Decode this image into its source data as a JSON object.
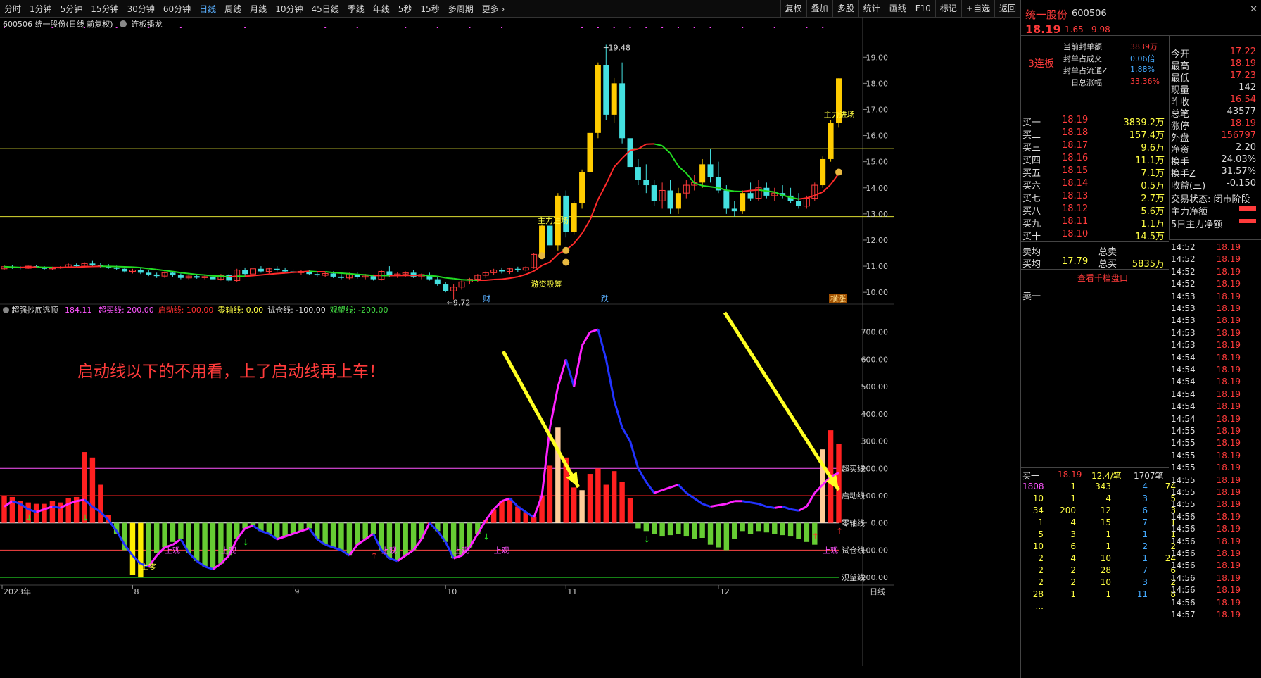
{
  "toolbar": {
    "periods": [
      "分时",
      "1分钟",
      "5分钟",
      "15分钟",
      "30分钟",
      "60分钟",
      "日线",
      "周线",
      "月线",
      "10分钟",
      "45日线",
      "季线",
      "年线",
      "5秒",
      "15秒",
      "多周期",
      "更多 ›"
    ],
    "active": "日线",
    "right_buttons": [
      "复权",
      "叠加",
      "多股",
      "统计",
      "画线",
      "F10",
      "标记",
      "+自选",
      "返回"
    ]
  },
  "chart_header": {
    "title": "600506 统一股份(日线 前复权)",
    "indicator": "连板播龙"
  },
  "price_axis": [
    "19.00",
    "18.00",
    "17.00",
    "16.00",
    "15.00",
    "14.00",
    "13.00",
    "12.00",
    "11.00",
    "10.00"
  ],
  "annotations": {
    "high": "19.48",
    "low": "9.72",
    "main_force_in_1": "主力进场",
    "main_force_in_2": "主力进场",
    "hot_money": "游资吸筹",
    "cai": "财",
    "die": "跌",
    "heng": "横涨"
  },
  "indicator_bar": {
    "name": "超强抄底逃顶",
    "value": "184.11",
    "lines": [
      {
        "label": "超买线: 200.00",
        "color": "#ff55ff"
      },
      {
        "label": "启动线: 100.00",
        "color": "#ff3030"
      },
      {
        "label": "零轴线: 0.00",
        "color": "#ffff44"
      },
      {
        "label": "试仓线: -100.00",
        "color": "#dddddd"
      },
      {
        "label": "观望线: -200.00",
        "color": "#44dd44"
      }
    ]
  },
  "lower_axis": [
    "700.00",
    "600.00",
    "500.00",
    "400.00",
    "300.00",
    "200.00",
    "100.00",
    "0.00",
    "-100.00",
    "-200.00"
  ],
  "lower_line_labels": [
    "超买线",
    "启动线",
    "零轴线",
    "试仓线",
    "观望线"
  ],
  "big_note": "启动线以下的不用看，上了启动线再上车！",
  "signal_labels": {
    "shang_ling": "上零",
    "shang_guan": "上观"
  },
  "date_axis": {
    "labels": [
      "2023年",
      "8",
      "9",
      "10",
      "11",
      "12"
    ],
    "period": "日线"
  },
  "chart_data": {
    "type": "candlestick",
    "ylim": [
      9.6,
      19.6
    ],
    "mid_lines": [
      15.5,
      12.9
    ],
    "ohlc": [
      [
        10.9,
        11.05,
        10.85,
        10.98
      ],
      [
        10.98,
        11.05,
        10.9,
        10.95
      ],
      [
        10.95,
        11.0,
        10.88,
        10.92
      ],
      [
        10.92,
        11.02,
        10.9,
        11.0
      ],
      [
        11.0,
        11.05,
        10.95,
        10.97
      ],
      [
        10.97,
        11.0,
        10.86,
        10.9
      ],
      [
        10.9,
        10.98,
        10.85,
        10.93
      ],
      [
        10.93,
        11.0,
        10.9,
        10.96
      ],
      [
        10.96,
        11.1,
        10.92,
        11.05
      ],
      [
        11.05,
        11.1,
        10.98,
        11.0
      ],
      [
        11.0,
        11.15,
        10.95,
        11.1
      ],
      [
        11.1,
        11.2,
        11.0,
        11.05
      ],
      [
        11.05,
        11.12,
        10.95,
        11.0
      ],
      [
        11.0,
        11.08,
        10.9,
        10.95
      ],
      [
        10.95,
        11.02,
        10.85,
        10.9
      ],
      [
        10.9,
        10.95,
        10.75,
        10.8
      ],
      [
        10.8,
        10.9,
        10.72,
        10.85
      ],
      [
        10.85,
        10.92,
        10.7,
        10.75
      ],
      [
        10.75,
        10.85,
        10.62,
        10.68
      ],
      [
        10.68,
        10.75,
        10.55,
        10.62
      ],
      [
        10.62,
        10.8,
        10.55,
        10.75
      ],
      [
        10.75,
        10.8,
        10.6,
        10.65
      ],
      [
        10.65,
        10.72,
        10.5,
        10.55
      ],
      [
        10.55,
        10.7,
        10.48,
        10.62
      ],
      [
        10.62,
        10.7,
        10.52,
        10.56
      ],
      [
        10.56,
        10.66,
        10.5,
        10.6
      ],
      [
        10.6,
        10.65,
        10.45,
        10.5
      ],
      [
        10.5,
        10.7,
        10.45,
        10.65
      ],
      [
        10.65,
        10.7,
        10.4,
        10.45
      ],
      [
        10.45,
        10.9,
        10.4,
        10.85
      ],
      [
        10.85,
        10.95,
        10.6,
        10.7
      ],
      [
        10.7,
        10.95,
        10.65,
        10.9
      ],
      [
        10.9,
        11.0,
        10.75,
        10.8
      ],
      [
        10.8,
        10.95,
        10.72,
        10.9
      ],
      [
        10.9,
        11.0,
        10.8,
        10.85
      ],
      [
        10.85,
        10.95,
        10.75,
        10.8
      ],
      [
        10.8,
        10.88,
        10.7,
        10.75
      ],
      [
        10.75,
        10.85,
        10.68,
        10.8
      ],
      [
        10.8,
        10.85,
        10.65,
        10.7
      ],
      [
        10.7,
        10.8,
        10.6,
        10.65
      ],
      [
        10.65,
        10.78,
        10.58,
        10.72
      ],
      [
        10.72,
        10.8,
        10.55,
        10.6
      ],
      [
        10.6,
        10.7,
        10.5,
        10.55
      ],
      [
        10.55,
        10.75,
        10.5,
        10.7
      ],
      [
        10.7,
        10.78,
        10.52,
        10.58
      ],
      [
        10.58,
        10.7,
        10.5,
        10.62
      ],
      [
        10.62,
        10.68,
        10.45,
        10.5
      ],
      [
        10.5,
        10.85,
        10.45,
        10.8
      ],
      [
        10.8,
        11.0,
        10.6,
        10.65
      ],
      [
        10.65,
        10.78,
        10.55,
        10.7
      ],
      [
        10.7,
        10.8,
        10.6,
        10.75
      ],
      [
        10.75,
        10.85,
        10.55,
        10.6
      ],
      [
        10.6,
        10.72,
        10.5,
        10.68
      ],
      [
        10.68,
        10.75,
        10.45,
        10.5
      ],
      [
        10.5,
        10.6,
        10.25,
        10.3
      ],
      [
        10.3,
        10.4,
        10.0,
        10.05
      ],
      [
        10.05,
        10.3,
        9.72,
        10.2
      ],
      [
        10.2,
        10.45,
        10.1,
        10.4
      ],
      [
        10.4,
        10.55,
        10.3,
        10.5
      ],
      [
        10.5,
        10.7,
        10.4,
        10.65
      ],
      [
        10.65,
        10.8,
        10.55,
        10.75
      ],
      [
        10.75,
        10.9,
        10.65,
        10.85
      ],
      [
        10.85,
        10.95,
        10.72,
        10.8
      ],
      [
        10.8,
        10.95,
        10.7,
        10.9
      ],
      [
        10.9,
        10.98,
        10.78,
        10.85
      ],
      [
        10.85,
        11.0,
        10.8,
        10.95
      ],
      [
        10.95,
        11.5,
        10.9,
        11.45
      ],
      [
        11.45,
        12.6,
        11.4,
        12.55
      ],
      [
        12.55,
        12.7,
        11.7,
        11.8
      ],
      [
        11.8,
        13.8,
        11.6,
        13.7
      ],
      [
        13.7,
        13.9,
        12.1,
        12.3
      ],
      [
        12.3,
        13.5,
        12.2,
        13.4
      ],
      [
        13.4,
        14.7,
        13.2,
        14.6
      ],
      [
        14.6,
        16.2,
        14.5,
        16.1
      ],
      [
        16.1,
        18.8,
        15.9,
        18.7
      ],
      [
        18.7,
        19.48,
        16.6,
        16.8
      ],
      [
        16.8,
        18.2,
        16.5,
        18.0
      ],
      [
        18.0,
        18.8,
        15.7,
        15.9
      ],
      [
        15.9,
        16.3,
        14.6,
        14.8
      ],
      [
        14.8,
        15.1,
        14.1,
        14.3
      ],
      [
        14.3,
        14.9,
        13.8,
        14.1
      ],
      [
        14.1,
        14.3,
        13.3,
        13.5
      ],
      [
        13.5,
        14.2,
        13.2,
        13.9
      ],
      [
        13.9,
        14.3,
        13.0,
        13.2
      ],
      [
        13.2,
        14.0,
        13.0,
        13.8
      ],
      [
        13.8,
        14.3,
        13.6,
        14.1
      ],
      [
        14.1,
        14.5,
        13.9,
        14.2
      ],
      [
        14.2,
        15.1,
        14.0,
        14.9
      ],
      [
        14.9,
        15.5,
        14.2,
        14.4
      ],
      [
        14.4,
        15.0,
        13.8,
        13.9
      ],
      [
        13.9,
        14.1,
        13.0,
        13.2
      ],
      [
        13.2,
        13.5,
        12.9,
        13.1
      ],
      [
        13.1,
        13.9,
        13.0,
        13.8
      ],
      [
        13.8,
        14.2,
        13.5,
        13.6
      ],
      [
        13.6,
        14.3,
        13.5,
        14.0
      ],
      [
        14.0,
        14.2,
        13.6,
        13.7
      ],
      [
        13.7,
        14.0,
        13.5,
        13.8
      ],
      [
        13.8,
        14.1,
        13.6,
        13.7
      ],
      [
        13.7,
        14.0,
        13.4,
        13.5
      ],
      [
        13.5,
        13.8,
        13.2,
        13.3
      ],
      [
        13.3,
        13.7,
        13.2,
        13.6
      ],
      [
        13.6,
        14.2,
        13.5,
        14.1
      ],
      [
        14.1,
        15.2,
        14.0,
        15.1
      ],
      [
        15.1,
        16.6,
        15.0,
        16.5
      ],
      [
        16.5,
        18.19,
        16.3,
        18.19
      ]
    ],
    "indicator": [
      60,
      80,
      70,
      50,
      40,
      50,
      60,
      55,
      70,
      80,
      85,
      60,
      40,
      10,
      -30,
      -80,
      -120,
      -150,
      -160,
      -120,
      -90,
      -80,
      -60,
      -110,
      -140,
      -160,
      -170,
      -150,
      -120,
      -60,
      -20,
      -10,
      -30,
      -40,
      -60,
      -50,
      -40,
      -30,
      -20,
      -60,
      -80,
      -90,
      -100,
      -120,
      -80,
      -60,
      -40,
      -100,
      -130,
      -140,
      -120,
      -100,
      -60,
      0,
      -30,
      -70,
      -130,
      -120,
      -90,
      -40,
      10,
      50,
      80,
      90,
      60,
      40,
      20,
      100,
      350,
      500,
      600,
      500,
      650,
      700,
      710,
      600,
      450,
      350,
      300,
      200,
      150,
      110,
      120,
      130,
      140,
      110,
      90,
      70,
      60,
      65,
      70,
      80,
      80,
      75,
      70,
      60,
      55,
      60,
      50,
      45,
      60,
      110,
      140,
      170,
      184
    ],
    "bars": [
      100,
      95,
      80,
      75,
      70,
      70,
      80,
      75,
      90,
      95,
      260,
      240,
      140,
      30,
      -40,
      -100,
      -190,
      -200,
      -160,
      -110,
      -90,
      -70,
      -60,
      -110,
      -140,
      -160,
      -170,
      -150,
      -120,
      -60,
      -20,
      -10,
      -30,
      -40,
      -60,
      -50,
      -40,
      -30,
      -20,
      -60,
      -80,
      -90,
      -100,
      -120,
      -80,
      -60,
      -40,
      -100,
      -130,
      -140,
      -120,
      -100,
      -60,
      0,
      -30,
      -70,
      -130,
      -120,
      -90,
      -40,
      10,
      50,
      80,
      90,
      60,
      40,
      20,
      100,
      210,
      350,
      240,
      130,
      120,
      180,
      200,
      140,
      190,
      150,
      90,
      -20,
      -30,
      -40,
      -50,
      -45,
      -40,
      -50,
      -60,
      -55,
      -80,
      -90,
      -100,
      -60,
      -30,
      -40,
      -30,
      -35,
      -40,
      -45,
      -50,
      -60,
      -70,
      -80,
      270,
      340,
      290
    ]
  },
  "right_panel": {
    "name": "统一股份",
    "code": "600506",
    "price": "18.19",
    "chg": "1.65",
    "pct": "9.98",
    "limit_board": "3连板",
    "seal_info": [
      [
        "当前封单额",
        "3839万"
      ],
      [
        "封单占成交",
        "0.06倍"
      ],
      [
        "封单占流通Z",
        "1.88%"
      ],
      [
        "十日总涨幅",
        "33.36%"
      ]
    ],
    "stats": [
      [
        "今开",
        "17.22"
      ],
      [
        "最高",
        "18.19"
      ],
      [
        "最低",
        "17.23"
      ],
      [
        "现量",
        "142"
      ],
      [
        "昨收",
        "16.54"
      ],
      [
        "总笔",
        "43577"
      ],
      [
        "涨停",
        "18.19"
      ],
      [
        "外盘",
        "156797"
      ],
      [
        "净资",
        "2.20"
      ],
      [
        "换手",
        "24.03%"
      ],
      [
        "换手Z",
        "31.57%"
      ],
      [
        "收益(三)",
        "-0.150"
      ]
    ],
    "trade_state": "交易状态: 闭市阶段",
    "main_net": "主力净额",
    "main_net_5": "5日主力净额",
    "bids": [
      [
        "买一",
        "18.19",
        "3839.2万"
      ],
      [
        "买二",
        "18.18",
        "157.4万"
      ],
      [
        "买三",
        "18.17",
        "9.6万"
      ],
      [
        "买四",
        "18.16",
        "11.1万"
      ],
      [
        "买五",
        "18.15",
        "7.1万"
      ],
      [
        "买六",
        "18.14",
        "0.5万"
      ],
      [
        "买七",
        "18.13",
        "2.7万"
      ],
      [
        "买八",
        "18.12",
        "5.6万"
      ],
      [
        "买九",
        "18.11",
        "1.1万"
      ],
      [
        "买十",
        "18.10",
        "14.5万"
      ]
    ],
    "sell_avg": [
      "卖均",
      "总卖"
    ],
    "buy_avg": [
      "买均",
      "17.79",
      "总买",
      "5835万"
    ],
    "view_orders": "查看千档盘口",
    "ask_one": "卖一",
    "queue_head": [
      "买一",
      "18.19",
      "12.4/笔",
      "1707笔"
    ],
    "queue": [
      [
        "1808",
        "1",
        "343",
        "4",
        "74"
      ],
      [
        "10",
        "1",
        "4",
        "3",
        "5"
      ],
      [
        "34",
        "200",
        "12",
        "6",
        "3"
      ],
      [
        "1",
        "4",
        "15",
        "7",
        "1"
      ],
      [
        "5",
        "3",
        "1",
        "1",
        "1"
      ],
      [
        "10",
        "6",
        "1",
        "2",
        "2"
      ],
      [
        "2",
        "4",
        "10",
        "1",
        "24"
      ],
      [
        "2",
        "2",
        "28",
        "7",
        "6"
      ],
      [
        "2",
        "2",
        "10",
        "3",
        "2"
      ],
      [
        "28",
        "1",
        "1",
        "11",
        "8"
      ],
      [
        "...",
        "",
        "",
        "",
        ""
      ]
    ],
    "ticks": [
      [
        "14:52",
        "18.19"
      ],
      [
        "14:52",
        "18.19"
      ],
      [
        "14:52",
        "18.19"
      ],
      [
        "14:52",
        "18.19"
      ],
      [
        "14:53",
        "18.19"
      ],
      [
        "14:53",
        "18.19"
      ],
      [
        "14:53",
        "18.19"
      ],
      [
        "14:53",
        "18.19"
      ],
      [
        "14:53",
        "18.19"
      ],
      [
        "14:54",
        "18.19"
      ],
      [
        "14:54",
        "18.19"
      ],
      [
        "14:54",
        "18.19"
      ],
      [
        "14:54",
        "18.19"
      ],
      [
        "14:54",
        "18.19"
      ],
      [
        "14:54",
        "18.19"
      ],
      [
        "14:55",
        "18.19"
      ],
      [
        "14:55",
        "18.19"
      ],
      [
        "14:55",
        "18.19"
      ],
      [
        "14:55",
        "18.19"
      ],
      [
        "14:55",
        "18.19"
      ],
      [
        "14:55",
        "18.19"
      ],
      [
        "14:55",
        "18.19"
      ],
      [
        "14:56",
        "18.19"
      ],
      [
        "14:56",
        "18.19"
      ],
      [
        "14:56",
        "18.19"
      ],
      [
        "14:56",
        "18.19"
      ],
      [
        "14:56",
        "18.19"
      ],
      [
        "14:56",
        "18.19"
      ],
      [
        "14:56",
        "18.19"
      ],
      [
        "14:56",
        "18.19"
      ],
      [
        "14:57",
        "18.19"
      ]
    ]
  }
}
